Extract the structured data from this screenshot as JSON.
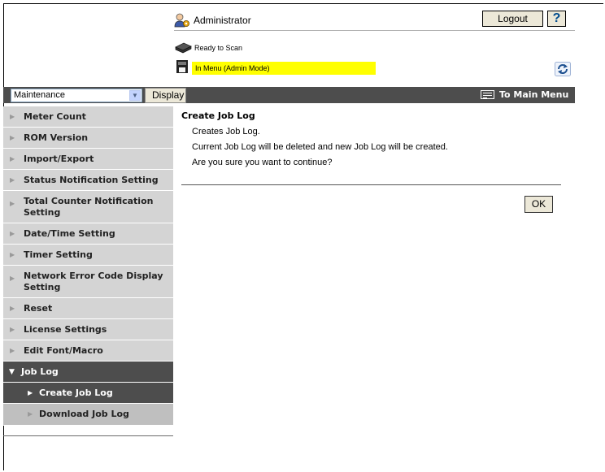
{
  "header": {
    "user_name": "Administrator",
    "logout_label": "Logout",
    "help_label": "?",
    "scanner_status": "Ready to Scan",
    "menu_status": "In Menu (Admin Mode)"
  },
  "toolbar": {
    "mode_selected": "Maintenance",
    "display_label": "Display",
    "main_menu_label": "To Main Menu"
  },
  "sidebar": {
    "items": [
      {
        "label": "Meter Count"
      },
      {
        "label": "ROM Version"
      },
      {
        "label": "Import/Export"
      },
      {
        "label": "Status Notification Setting"
      },
      {
        "label": "Total Counter Notification Setting"
      },
      {
        "label": "Date/Time Setting"
      },
      {
        "label": "Timer Setting"
      },
      {
        "label": "Network Error Code Display Setting"
      },
      {
        "label": "Reset"
      },
      {
        "label": "License Settings"
      },
      {
        "label": "Edit Font/Macro"
      },
      {
        "label": "Job Log"
      },
      {
        "label": "Create Job Log"
      },
      {
        "label": "Download Job Log"
      }
    ]
  },
  "main": {
    "title": "Create Job Log",
    "lines": [
      "Creates Job Log.",
      "Current Job Log will be deleted and new Job Log will be created.",
      "Are you sure you want to continue?"
    ],
    "ok_label": "OK"
  },
  "colors": {
    "nav_bar": "#4d4d4d",
    "status_highlight": "#ffff00",
    "sidebar_bg": "#d4d4d4"
  }
}
